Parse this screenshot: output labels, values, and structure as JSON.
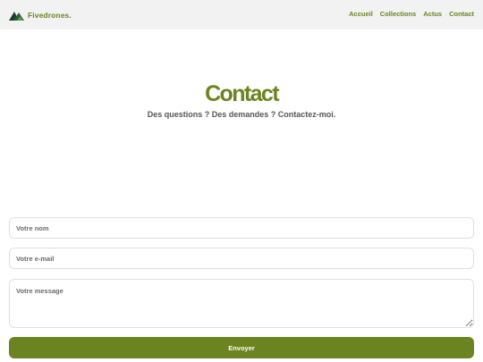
{
  "header": {
    "brand_name": "Fivedrones.",
    "logo_icon": "mountain-logo-icon",
    "nav": [
      {
        "label": "Accueil"
      },
      {
        "label": "Collections"
      },
      {
        "label": "Actus"
      },
      {
        "label": "Contact"
      }
    ]
  },
  "hero": {
    "title": "Contact",
    "subtitle": "Des questions ? Des demandes ? Contactez-moi."
  },
  "form": {
    "name_placeholder": "Votre nom",
    "name_value": "",
    "email_placeholder": "Votre e-mail",
    "email_value": "",
    "message_placeholder": "Votre message",
    "message_value": "",
    "submit_label": "Envoyer"
  },
  "colors": {
    "accent": "#6b8320",
    "header_bg": "#f2f2f2",
    "logo_dark": "#1f3d2e",
    "logo_light": "#5c9a3a"
  }
}
